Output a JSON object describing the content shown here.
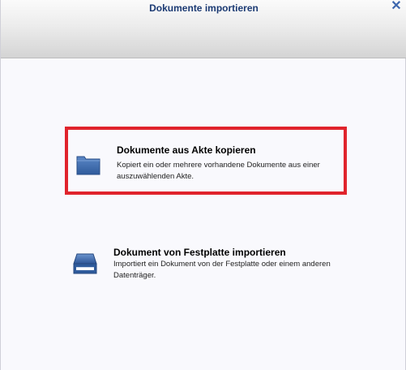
{
  "dialog": {
    "title": "Dokumente importieren",
    "close_icon": "close-icon"
  },
  "options": [
    {
      "label": "Dokumente aus Akte kopieren",
      "description": "Kopiert ein oder mehrere vorhandene Dokumente aus einer auszuwählenden Akte.",
      "icon": "folder-icon",
      "highlighted": true
    },
    {
      "label": "Dokument von Festplatte importieren",
      "description": "Importiert ein Dokument von der Festplatte oder einem anderen Datenträger.",
      "icon": "hard-drive-icon",
      "highlighted": false
    }
  ],
  "colors": {
    "title_text": "#1b3a73",
    "close_icon": "#3d67ad",
    "highlight_border": "#e0242c",
    "folder": "#3c6aad"
  }
}
